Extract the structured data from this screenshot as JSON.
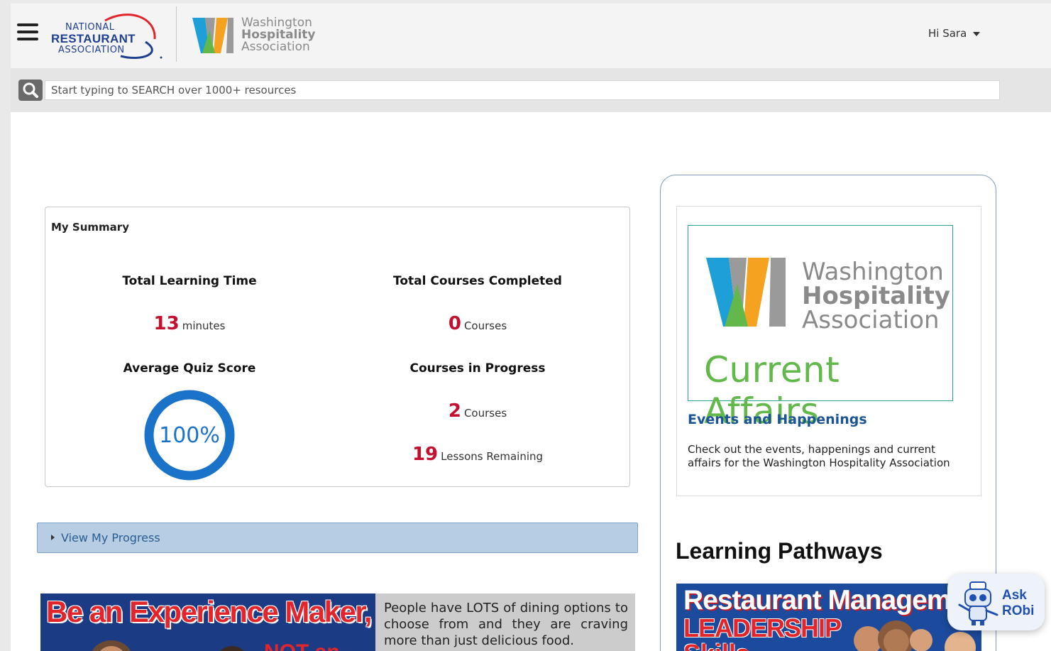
{
  "header": {
    "nra_logo": {
      "line1": "NATIONAL",
      "line2": "RESTAURANT",
      "line3": "ASSOCIATION"
    },
    "wha_logo": {
      "line1": "Washington",
      "line2": "Hospitality",
      "line3": "Association"
    },
    "user_greeting": "Hi Sara"
  },
  "search": {
    "placeholder": "Start typing to SEARCH over 1000+ resources"
  },
  "summary": {
    "title": "My Summary",
    "total_learning_time": {
      "label": "Total Learning Time",
      "value": "13",
      "unit": "minutes"
    },
    "total_courses_completed": {
      "label": "Total Courses Completed",
      "value": "0",
      "unit": "Courses"
    },
    "average_quiz_score": {
      "label": "Average Quiz Score",
      "value": "100%",
      "fraction": 1.0
    },
    "courses_in_progress": {
      "label": "Courses in Progress",
      "value": "2",
      "unit": "Courses"
    },
    "lessons_remaining": {
      "value": "19",
      "unit": "Lessons Remaining"
    }
  },
  "progress_toggle": {
    "label": "View My Progress"
  },
  "banner": {
    "headline": "Be an Experience Maker,",
    "overlay_text": "NOT an",
    "body": "People have LOTS of dining options to choose from and they are craving more than just delicious food."
  },
  "current_affairs": {
    "image_logo": {
      "line1": "Washington",
      "line2": "Hospitality",
      "line3": "Association"
    },
    "image_caption": "Current Affairs",
    "title": "Events and Happenings",
    "description": "Check out the events, happenings and current affairs for the Washington Hospitality Association"
  },
  "learning_pathways": {
    "title": "Learning Pathways",
    "card": {
      "line1": "Restaurant Manageme",
      "line2": "LEADERSHIP",
      "line3": "Skills"
    }
  },
  "ask_robi": {
    "line1": "Ask",
    "line2": "RObi"
  },
  "colors": {
    "accent_red": "#c4102e",
    "link_blue": "#1d5594",
    "donut_blue": "#1a73c9",
    "affairs_green": "#62b84a",
    "progress_bar_bg": "#b6cde3"
  }
}
